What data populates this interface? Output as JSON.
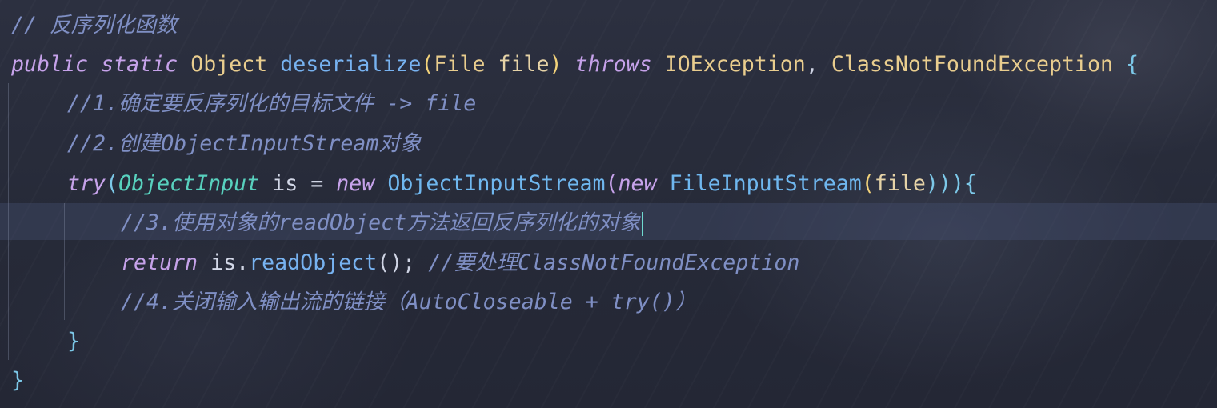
{
  "editor": {
    "lines": {
      "l1": {
        "comment": "// 反序列化函数"
      },
      "l2": {
        "kw_public": "public",
        "kw_static": "static",
        "ret_type": "Object",
        "method_name": "deserialize",
        "open_paren": "(",
        "param_type": "File",
        "param_name": "file",
        "close_paren": ")",
        "kw_throws": "throws",
        "ex1": "IOException",
        "comma": ",",
        "ex2": "ClassNotFoundException",
        "open_brace": "{"
      },
      "l3": {
        "comment": "//1.确定要反序列化的目标文件 -> file"
      },
      "l4": {
        "comment": "//2.创建ObjectInputStream对象"
      },
      "l5": {
        "kw_try": "try",
        "open_paren": "(",
        "iface": "ObjectInput",
        "var": "is",
        "eq": "=",
        "kw_new1": "new",
        "cls1": "ObjectInputStream",
        "p2": "(",
        "kw_new2": "new",
        "cls2": "FileInputStream",
        "p3": "(",
        "arg": "file",
        "close_parens": ")))",
        "open_brace": "{"
      },
      "l6": {
        "comment": "//3.使用对象的readObject方法返回反序列化的对象"
      },
      "l7": {
        "kw_return": "return",
        "var": "is",
        "dot": ".",
        "method": "readObject",
        "call": "();",
        "comment": "//要处理ClassNotFoundException"
      },
      "l8": {
        "comment": "//4.关闭输入输出流的链接（AutoCloseable + try()）"
      },
      "l9": {
        "close_brace": "}"
      },
      "l10": {
        "close_brace": "}"
      }
    },
    "colors": {
      "background": "#272a38",
      "comment": "#7f8fc4",
      "keyword": "#c6a2ea",
      "type": "#e9cd8e",
      "function": "#77b2f0",
      "interface": "#58d1be",
      "caret": "#6fd9cf"
    }
  }
}
